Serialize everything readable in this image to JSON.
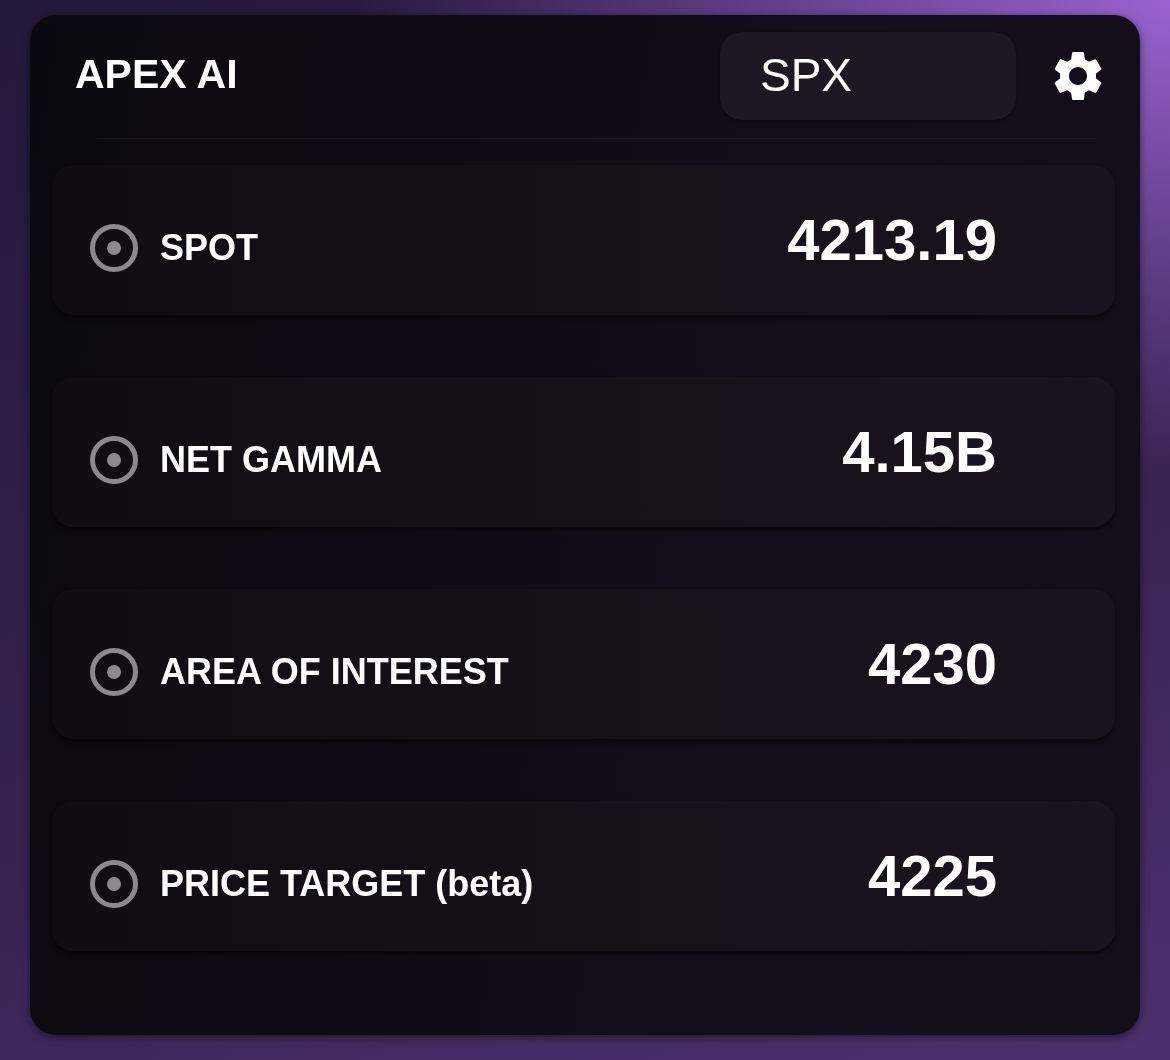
{
  "header": {
    "title": "APEX AI",
    "ticker_field": {
      "value": "SPX"
    }
  },
  "metrics": [
    {
      "label": "SPOT",
      "value": "4213.19"
    },
    {
      "label": "NET GAMMA",
      "value": "4.15B"
    },
    {
      "label": "AREA OF INTEREST",
      "value": "4230"
    },
    {
      "label": "PRICE TARGET (beta)",
      "value": "4225"
    }
  ]
}
